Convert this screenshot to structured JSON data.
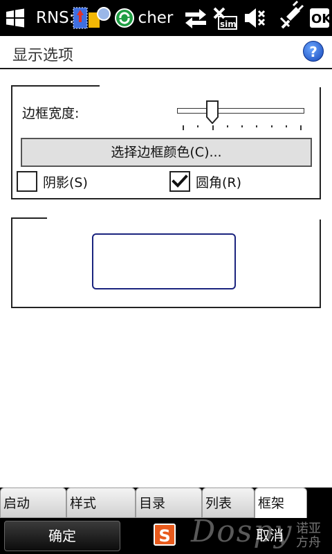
{
  "status_bar": {
    "app_title": "RNS:",
    "app_title_tail": "cher",
    "icons": [
      "windows-logo-icon",
      "data-transfer-icon",
      "no-sim-icon",
      "volume-off-icon",
      "charging-icon",
      "ok-button"
    ],
    "ok_label": "OK"
  },
  "header": {
    "title": "显示选项",
    "help_label": "?"
  },
  "border_group": {
    "width_label": "边框宽度:",
    "slider_ticks": 9,
    "slider_value": 0.25,
    "color_button_label": "选择边框颜色(C)...",
    "shadow_label": "阴影(S)",
    "shadow_checked": false,
    "rounded_label": "圆角(R)",
    "rounded_checked": true
  },
  "preview_group": {
    "border_color": "#1a237e"
  },
  "tabs": [
    {
      "label": "启动"
    },
    {
      "label": "样式"
    },
    {
      "label": "目录"
    },
    {
      "label": "列表"
    },
    {
      "label": "框架"
    }
  ],
  "active_tab": 4,
  "softkeys": {
    "left": "确定",
    "right": "取消",
    "ime_label": "S"
  },
  "watermark": {
    "text": "Dospy",
    "cn": "诺亚方舟"
  }
}
